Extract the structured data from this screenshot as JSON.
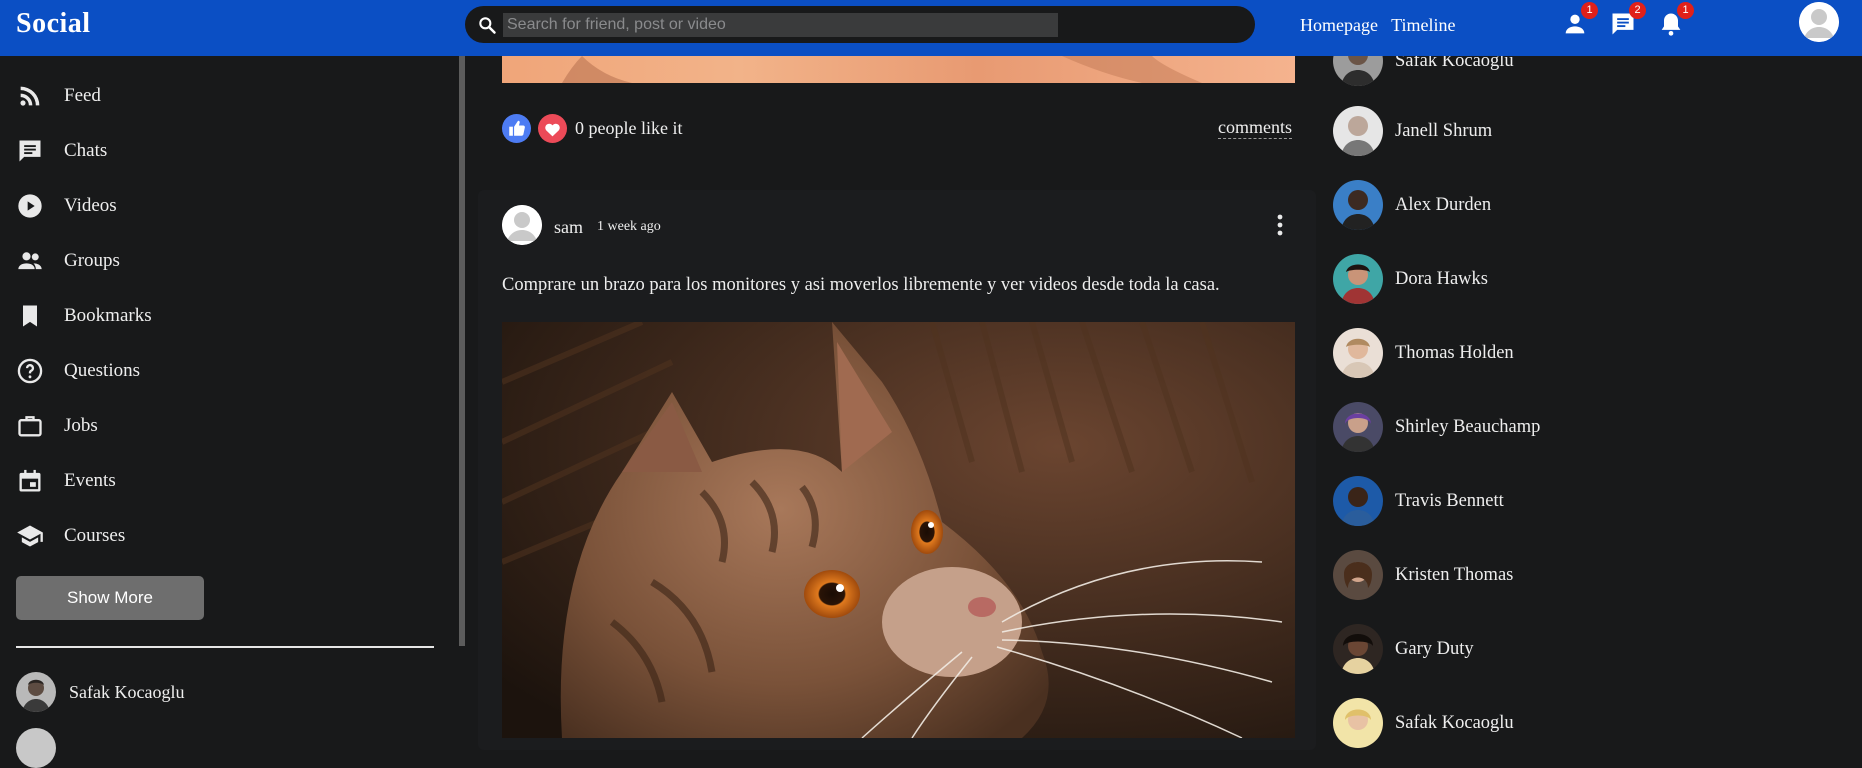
{
  "header": {
    "logo": "Social",
    "search_placeholder": "Search for friend, post or video",
    "links": [
      "Homepage",
      "Timeline"
    ],
    "badges": {
      "friends": "1",
      "messages": "2",
      "notifications": "1"
    }
  },
  "sidebar": {
    "items": [
      {
        "label": "Feed",
        "icon": "rss-icon"
      },
      {
        "label": "Chats",
        "icon": "chat-icon"
      },
      {
        "label": "Videos",
        "icon": "play-circle-icon"
      },
      {
        "label": "Groups",
        "icon": "group-icon"
      },
      {
        "label": "Bookmarks",
        "icon": "bookmark-icon"
      },
      {
        "label": "Questions",
        "icon": "help-circle-icon"
      },
      {
        "label": "Jobs",
        "icon": "briefcase-icon"
      },
      {
        "label": "Events",
        "icon": "calendar-icon"
      },
      {
        "label": "Courses",
        "icon": "school-icon"
      }
    ],
    "show_more": "Show More",
    "friends": [
      "Safak Kocaoglu"
    ]
  },
  "feed": {
    "prev_post": {
      "likes_text": "0 people like it",
      "comments": "comments"
    },
    "post": {
      "user": "sam",
      "time": "1 week ago",
      "text": "Comprare un brazo para los monitores y asi moverlos libremente y ver videos desde toda la casa."
    }
  },
  "online": {
    "friends": [
      "Safak Kocaoglu",
      "Janell Shrum",
      "Alex Durden",
      "Dora Hawks",
      "Thomas Holden",
      "Shirley Beauchamp",
      "Travis Bennett",
      "Kristen Thomas",
      "Gary Duty",
      "Safak Kocaoglu"
    ],
    "status_color": "#3bb54a"
  },
  "colors": {
    "topbar": "#0b4fc4",
    "background": "#18191a",
    "badge": "#e0201a",
    "like_blue": "#4d7cf3",
    "like_red": "#ec4a58"
  }
}
